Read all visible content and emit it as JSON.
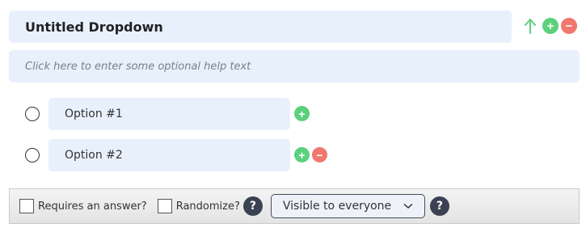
{
  "question": {
    "title": "Untitled Dropdown",
    "help_placeholder": "Click here to enter some optional help text"
  },
  "options": [
    {
      "label": "Option #1"
    },
    {
      "label": "Option #2"
    }
  ],
  "icons": {
    "move_up": "↑",
    "add": "+",
    "remove": "−",
    "help": "?",
    "chevron": "⌄"
  },
  "footer": {
    "required_label": "Requires an answer?",
    "randomize_label": "Randomize?",
    "visibility_value": "Visible to everyone"
  },
  "colors": {
    "field_bg": "#e8f0fc",
    "add": "#5bd07d",
    "remove": "#f0786e",
    "help_bg": "#3b4252",
    "arrow": "#5bd07d"
  }
}
